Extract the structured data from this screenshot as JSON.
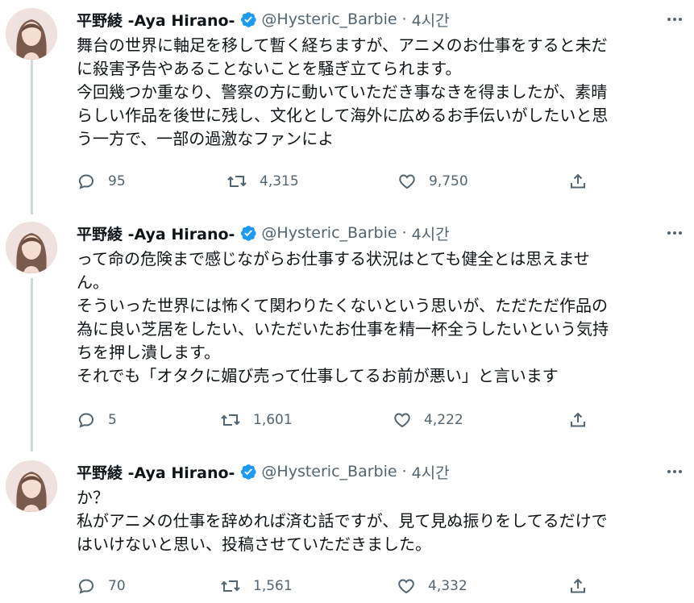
{
  "tweets": [
    {
      "author": {
        "name": "平野綾 -Aya Hirano-",
        "handle": "@Hysteric_Barbie",
        "time": "4시간"
      },
      "lines": [
        "舞台の世界に軸足を移して暫く経ちますが、アニメのお仕事をすると未だ",
        "に殺害予告やあることないことを騒ぎ立てられます。",
        "今回幾つか重なり、警察の方に動いていただき事なきを得ましたが、素晴",
        "らしい作品を後世に残し、文化として海外に広めるお手伝いがしたいと思",
        "う一方で、一部の過激なファンによ"
      ],
      "stats": {
        "replies": "95",
        "retweets": "4,315",
        "likes": "9,750"
      }
    },
    {
      "author": {
        "name": "平野綾 -Aya Hirano-",
        "handle": "@Hysteric_Barbie",
        "time": "4시간"
      },
      "lines": [
        "って命の危険まで感じながらお仕事する状況はとても健全とは思えませ",
        "ん。",
        "そういった世界には怖くて関わりたくないという思いが、ただただ作品の",
        "為に良い芝居をしたい、いただいたお仕事を精一杯全うしたいという気持",
        "ちを押し潰します。",
        "それでも「オタクに媚び売って仕事してるお前が悪い」と言います"
      ],
      "stats": {
        "replies": "5",
        "retweets": "1,601",
        "likes": "4,222"
      }
    },
    {
      "author": {
        "name": "平野綾 -Aya Hirano-",
        "handle": "@Hysteric_Barbie",
        "time": "4시간"
      },
      "lines": [
        "か？",
        "私がアニメの仕事を辞めれば済む話ですが、見て見ぬ振りをしてるだけで",
        "はいけないと思い、投稿させていただきました。"
      ],
      "stats": {
        "replies": "70",
        "retweets": "1,561",
        "likes": "4,332"
      }
    }
  ],
  "colors": {
    "verified": "#1d9bf0",
    "muted_text": "#536471",
    "thread_line": "#cfd9de"
  },
  "icons": {
    "reply": "reply-icon",
    "retweet": "retweet-icon",
    "like": "heart-icon",
    "share": "share-icon",
    "more": "more-icon",
    "verified": "verified-badge-icon"
  }
}
